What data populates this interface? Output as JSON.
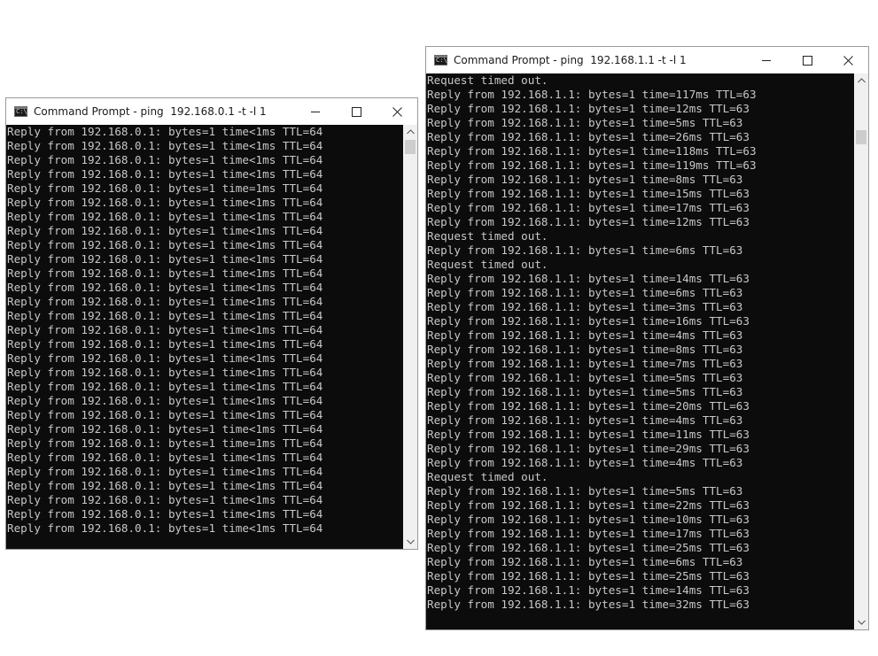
{
  "left_window": {
    "title": "Command Prompt - ping  192.168.0.1 -t -l 1",
    "lines": [
      "Reply from 192.168.0.1: bytes=1 time<1ms TTL=64",
      "Reply from 192.168.0.1: bytes=1 time<1ms TTL=64",
      "Reply from 192.168.0.1: bytes=1 time<1ms TTL=64",
      "Reply from 192.168.0.1: bytes=1 time<1ms TTL=64",
      "Reply from 192.168.0.1: bytes=1 time=1ms TTL=64",
      "Reply from 192.168.0.1: bytes=1 time<1ms TTL=64",
      "Reply from 192.168.0.1: bytes=1 time<1ms TTL=64",
      "Reply from 192.168.0.1: bytes=1 time<1ms TTL=64",
      "Reply from 192.168.0.1: bytes=1 time<1ms TTL=64",
      "Reply from 192.168.0.1: bytes=1 time<1ms TTL=64",
      "Reply from 192.168.0.1: bytes=1 time<1ms TTL=64",
      "Reply from 192.168.0.1: bytes=1 time<1ms TTL=64",
      "Reply from 192.168.0.1: bytes=1 time<1ms TTL=64",
      "Reply from 192.168.0.1: bytes=1 time<1ms TTL=64",
      "Reply from 192.168.0.1: bytes=1 time<1ms TTL=64",
      "Reply from 192.168.0.1: bytes=1 time<1ms TTL=64",
      "Reply from 192.168.0.1: bytes=1 time<1ms TTL=64",
      "Reply from 192.168.0.1: bytes=1 time<1ms TTL=64",
      "Reply from 192.168.0.1: bytes=1 time<1ms TTL=64",
      "Reply from 192.168.0.1: bytes=1 time<1ms TTL=64",
      "Reply from 192.168.0.1: bytes=1 time<1ms TTL=64",
      "Reply from 192.168.0.1: bytes=1 time<1ms TTL=64",
      "Reply from 192.168.0.1: bytes=1 time=1ms TTL=64",
      "Reply from 192.168.0.1: bytes=1 time<1ms TTL=64",
      "Reply from 192.168.0.1: bytes=1 time<1ms TTL=64",
      "Reply from 192.168.0.1: bytes=1 time<1ms TTL=64",
      "Reply from 192.168.0.1: bytes=1 time<1ms TTL=64",
      "Reply from 192.168.0.1: bytes=1 time<1ms TTL=64",
      "Reply from 192.168.0.1: bytes=1 time<1ms TTL=64"
    ]
  },
  "right_window": {
    "title": "Command Prompt - ping  192.168.1.1 -t -l 1",
    "lines": [
      "Request timed out.",
      "Reply from 192.168.1.1: bytes=1 time=117ms TTL=63",
      "Reply from 192.168.1.1: bytes=1 time=12ms TTL=63",
      "Reply from 192.168.1.1: bytes=1 time=5ms TTL=63",
      "Reply from 192.168.1.1: bytes=1 time=26ms TTL=63",
      "Reply from 192.168.1.1: bytes=1 time=118ms TTL=63",
      "Reply from 192.168.1.1: bytes=1 time=119ms TTL=63",
      "Reply from 192.168.1.1: bytes=1 time=8ms TTL=63",
      "Reply from 192.168.1.1: bytes=1 time=15ms TTL=63",
      "Reply from 192.168.1.1: bytes=1 time=17ms TTL=63",
      "Reply from 192.168.1.1: bytes=1 time=12ms TTL=63",
      "Request timed out.",
      "Reply from 192.168.1.1: bytes=1 time=6ms TTL=63",
      "Request timed out.",
      "Reply from 192.168.1.1: bytes=1 time=14ms TTL=63",
      "Reply from 192.168.1.1: bytes=1 time=6ms TTL=63",
      "Reply from 192.168.1.1: bytes=1 time=3ms TTL=63",
      "Reply from 192.168.1.1: bytes=1 time=16ms TTL=63",
      "Reply from 192.168.1.1: bytes=1 time=4ms TTL=63",
      "Reply from 192.168.1.1: bytes=1 time=8ms TTL=63",
      "Reply from 192.168.1.1: bytes=1 time=7ms TTL=63",
      "Reply from 192.168.1.1: bytes=1 time=5ms TTL=63",
      "Reply from 192.168.1.1: bytes=1 time=5ms TTL=63",
      "Reply from 192.168.1.1: bytes=1 time=20ms TTL=63",
      "Reply from 192.168.1.1: bytes=1 time=4ms TTL=63",
      "Reply from 192.168.1.1: bytes=1 time=11ms TTL=63",
      "Reply from 192.168.1.1: bytes=1 time=29ms TTL=63",
      "Reply from 192.168.1.1: bytes=1 time=4ms TTL=63",
      "Request timed out.",
      "Reply from 192.168.1.1: bytes=1 time=5ms TTL=63",
      "Reply from 192.168.1.1: bytes=1 time=22ms TTL=63",
      "Reply from 192.168.1.1: bytes=1 time=10ms TTL=63",
      "Reply from 192.168.1.1: bytes=1 time=17ms TTL=63",
      "Reply from 192.168.1.1: bytes=1 time=25ms TTL=63",
      "Reply from 192.168.1.1: bytes=1 time=6ms TTL=63",
      "Reply from 192.168.1.1: bytes=1 time=25ms TTL=63",
      "Reply from 192.168.1.1: bytes=1 time=14ms TTL=63",
      "Reply from 192.168.1.1: bytes=1 time=32ms TTL=63"
    ]
  },
  "colors": {
    "console_bg": "#0c0c0c",
    "console_text": "#c8c8c8",
    "titlebar_bg": "#ffffff"
  },
  "icons": {
    "app": "command-prompt-icon",
    "minimize": "minimize-icon",
    "maximize": "maximize-icon",
    "close": "close-icon",
    "scroll_up": "chevron-up-icon",
    "scroll_down": "chevron-down-icon"
  }
}
